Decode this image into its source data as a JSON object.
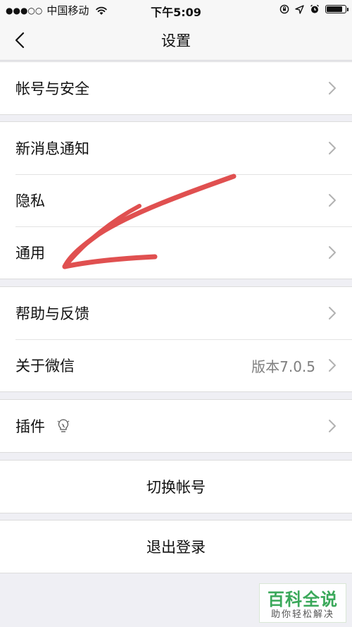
{
  "status_bar": {
    "signal": "●●●○○",
    "carrier": "中国移动",
    "time": "下午5:09",
    "battery_level": 0.85
  },
  "nav": {
    "title": "设置"
  },
  "groups": {
    "account": {
      "security_label": "帐号与安全"
    },
    "notify": {
      "new_message_label": "新消息通知",
      "privacy_label": "隐私",
      "general_label": "通用"
    },
    "help": {
      "feedback_label": "帮助与反馈",
      "about_label": "关于微信",
      "version_value": "版本7.0.5"
    },
    "plugins": {
      "plugins_label": "插件"
    },
    "switch_account_label": "切换帐号",
    "logout_label": "退出登录"
  },
  "annotation": {
    "color": "#e05050"
  },
  "watermark": {
    "title": "百科全说",
    "subtitle": "助你轻松解决"
  },
  "colors": {
    "background": "#efeff4",
    "secondary_text": "#7f7f7f",
    "watermark_green": "#3aa85a"
  }
}
